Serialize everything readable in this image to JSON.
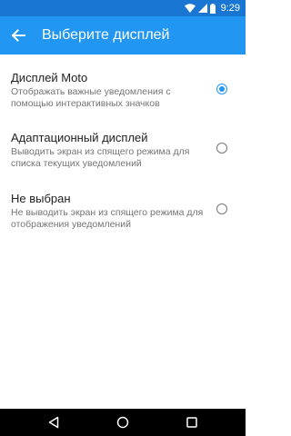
{
  "status_bar": {
    "time": "9:29",
    "icons": [
      "wifi-icon",
      "signal-icon",
      "battery-icon"
    ]
  },
  "header": {
    "title": "Выберите дисплей",
    "back_icon": "arrow-back-icon"
  },
  "options": [
    {
      "title": "Дисплей Moto",
      "subtitle": "Отображать важные уведомления с помощью интерактивных значков",
      "selected": true
    },
    {
      "title": "Адаптационный дисплей",
      "subtitle": "Выводить экран из спящего режима для списка текущих уведомлений",
      "selected": false
    },
    {
      "title": "Не выбран",
      "subtitle": "Не выводить экран из спящего режима для отображения уведомлений",
      "selected": false
    }
  ],
  "nav_bar": {
    "buttons": [
      "back-triangle-icon",
      "home-circle-icon",
      "recents-square-icon"
    ]
  },
  "colors": {
    "status_bar": "#1976d2",
    "app_bar": "#2196f3",
    "accent": "#2196f3",
    "nav_bar": "#000000"
  }
}
